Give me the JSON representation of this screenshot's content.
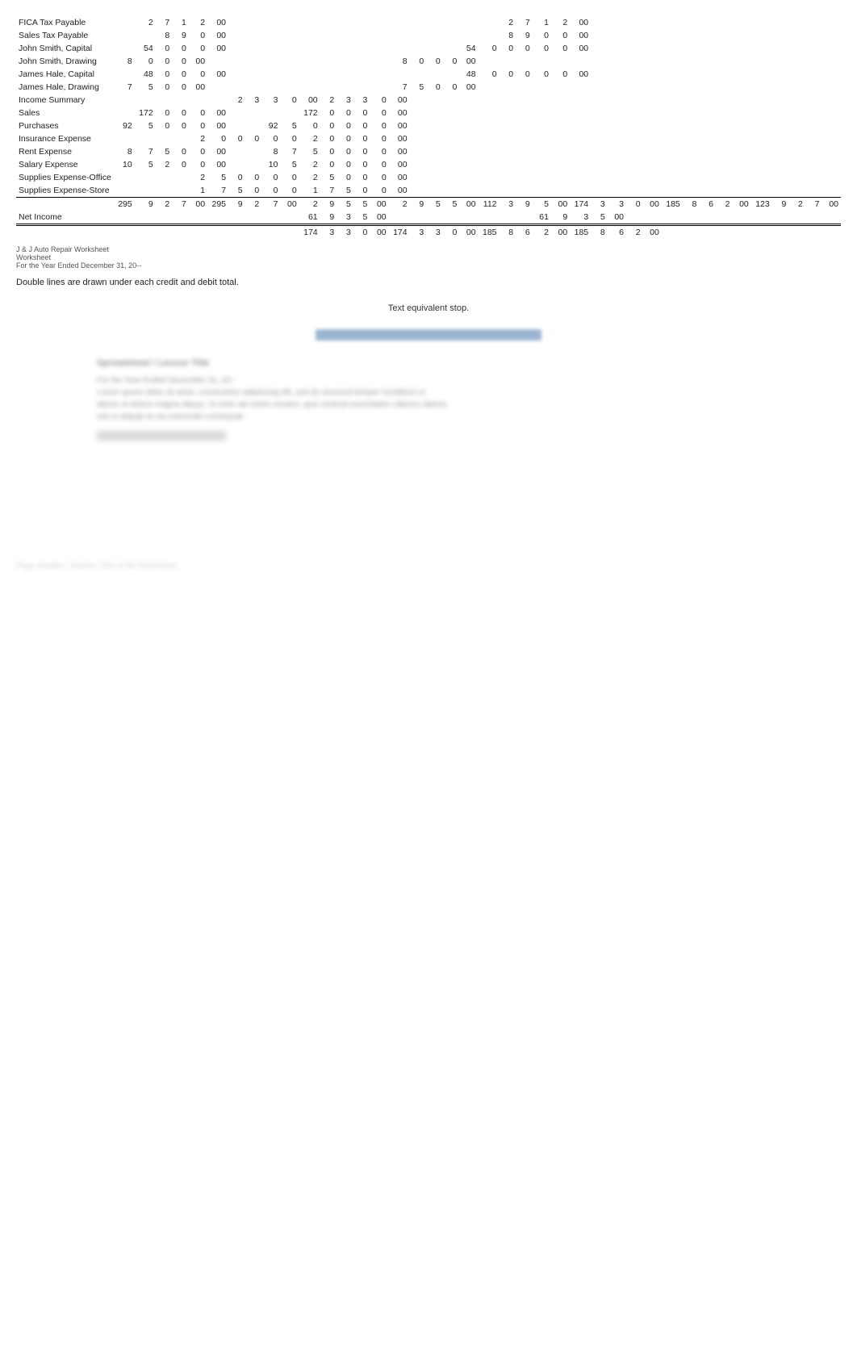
{
  "title": "J & J Auto Repair Worksheet",
  "subtitle": "For the Year Ended December 31, 20--",
  "rows": [
    {
      "label": "FICA Tax Payable",
      "cols": [
        null,
        "2",
        "7",
        "1",
        "2",
        "00",
        null,
        null,
        null,
        null,
        null,
        null,
        null,
        null,
        null,
        null,
        null,
        null,
        null,
        null,
        null,
        null,
        "2",
        "7",
        "1",
        "2",
        "00"
      ]
    }
  ],
  "footer_note": "Double lines are drawn under each credit and debit total.",
  "text_equiv": "Text equivalent stop."
}
